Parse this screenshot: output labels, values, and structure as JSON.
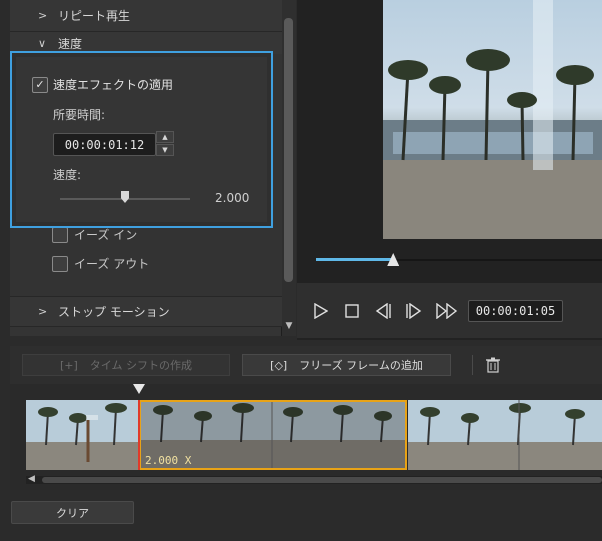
{
  "settings": {
    "repeat_label": "リピート再生",
    "speed_label": "速度",
    "apply_speed_label": "速度エフェクトの適用",
    "apply_speed_checked": true,
    "duration_label": "所要時間:",
    "duration_value": "00:00:01:12",
    "speed_slider_label": "速度:",
    "speed_value": "2.000",
    "speed_slider_position": 0.5,
    "ease_in_label": "イーズ イン",
    "ease_out_label": "イーズ アウト",
    "stop_motion_label": "ストップ モーション"
  },
  "preview": {
    "timecode": "00:00:01:05",
    "scrub_position": 0.27
  },
  "toolbar": {
    "time_shift_label": "タイム シフトの作成",
    "freeze_frame_label": "フリーズ フレームの追加"
  },
  "timeline": {
    "selected_clip_badge": "2.000 X"
  },
  "footer": {
    "clear_label": "クリア"
  },
  "colors": {
    "highlight_border": "#3fa0e0",
    "selection_border": "#e8a317",
    "playhead": "#e03a2a",
    "scrub_fill": "#5fb8e8"
  }
}
